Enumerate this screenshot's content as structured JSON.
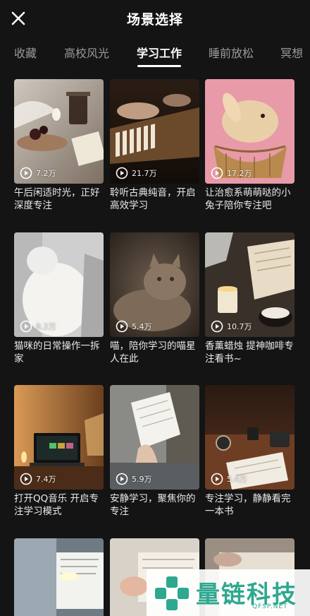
{
  "header": {
    "title": "场景选择"
  },
  "tabs": [
    {
      "label": "收藏"
    },
    {
      "label": "高校风光"
    },
    {
      "label": "学习工作"
    },
    {
      "label": "睡前放松"
    },
    {
      "label": "冥想"
    }
  ],
  "active_tab": "学习工作",
  "cards": [
    {
      "title": "午后闲适时光，正好深度专注",
      "plays": "7.2万"
    },
    {
      "title": "聆听古典纯音，开启高效学习",
      "plays": "21.7万"
    },
    {
      "title": "让治愈系萌萌哒的小兔子陪你专注吧",
      "plays": "17.2万"
    },
    {
      "title": "猫咪的日常操作一拆家",
      "plays": "8.2万"
    },
    {
      "title": "喵，陪你学习的喵星人在此",
      "plays": "5.4万"
    },
    {
      "title": "香薰蜡烛 提神咖啡专注看书~",
      "plays": "10.7万"
    },
    {
      "title": "打开QQ音乐 开启专注学习模式",
      "plays": "7.4万"
    },
    {
      "title": "安静学习，聚焦你的专注",
      "plays": "5.9万"
    },
    {
      "title": "专注学习，静静看完一本书",
      "plays": "5.4万"
    }
  ],
  "watermark": {
    "name": "量链科技",
    "domain": "QFSP.NET"
  },
  "colors": {
    "background": "#141414",
    "accent": "#2ea88f"
  }
}
